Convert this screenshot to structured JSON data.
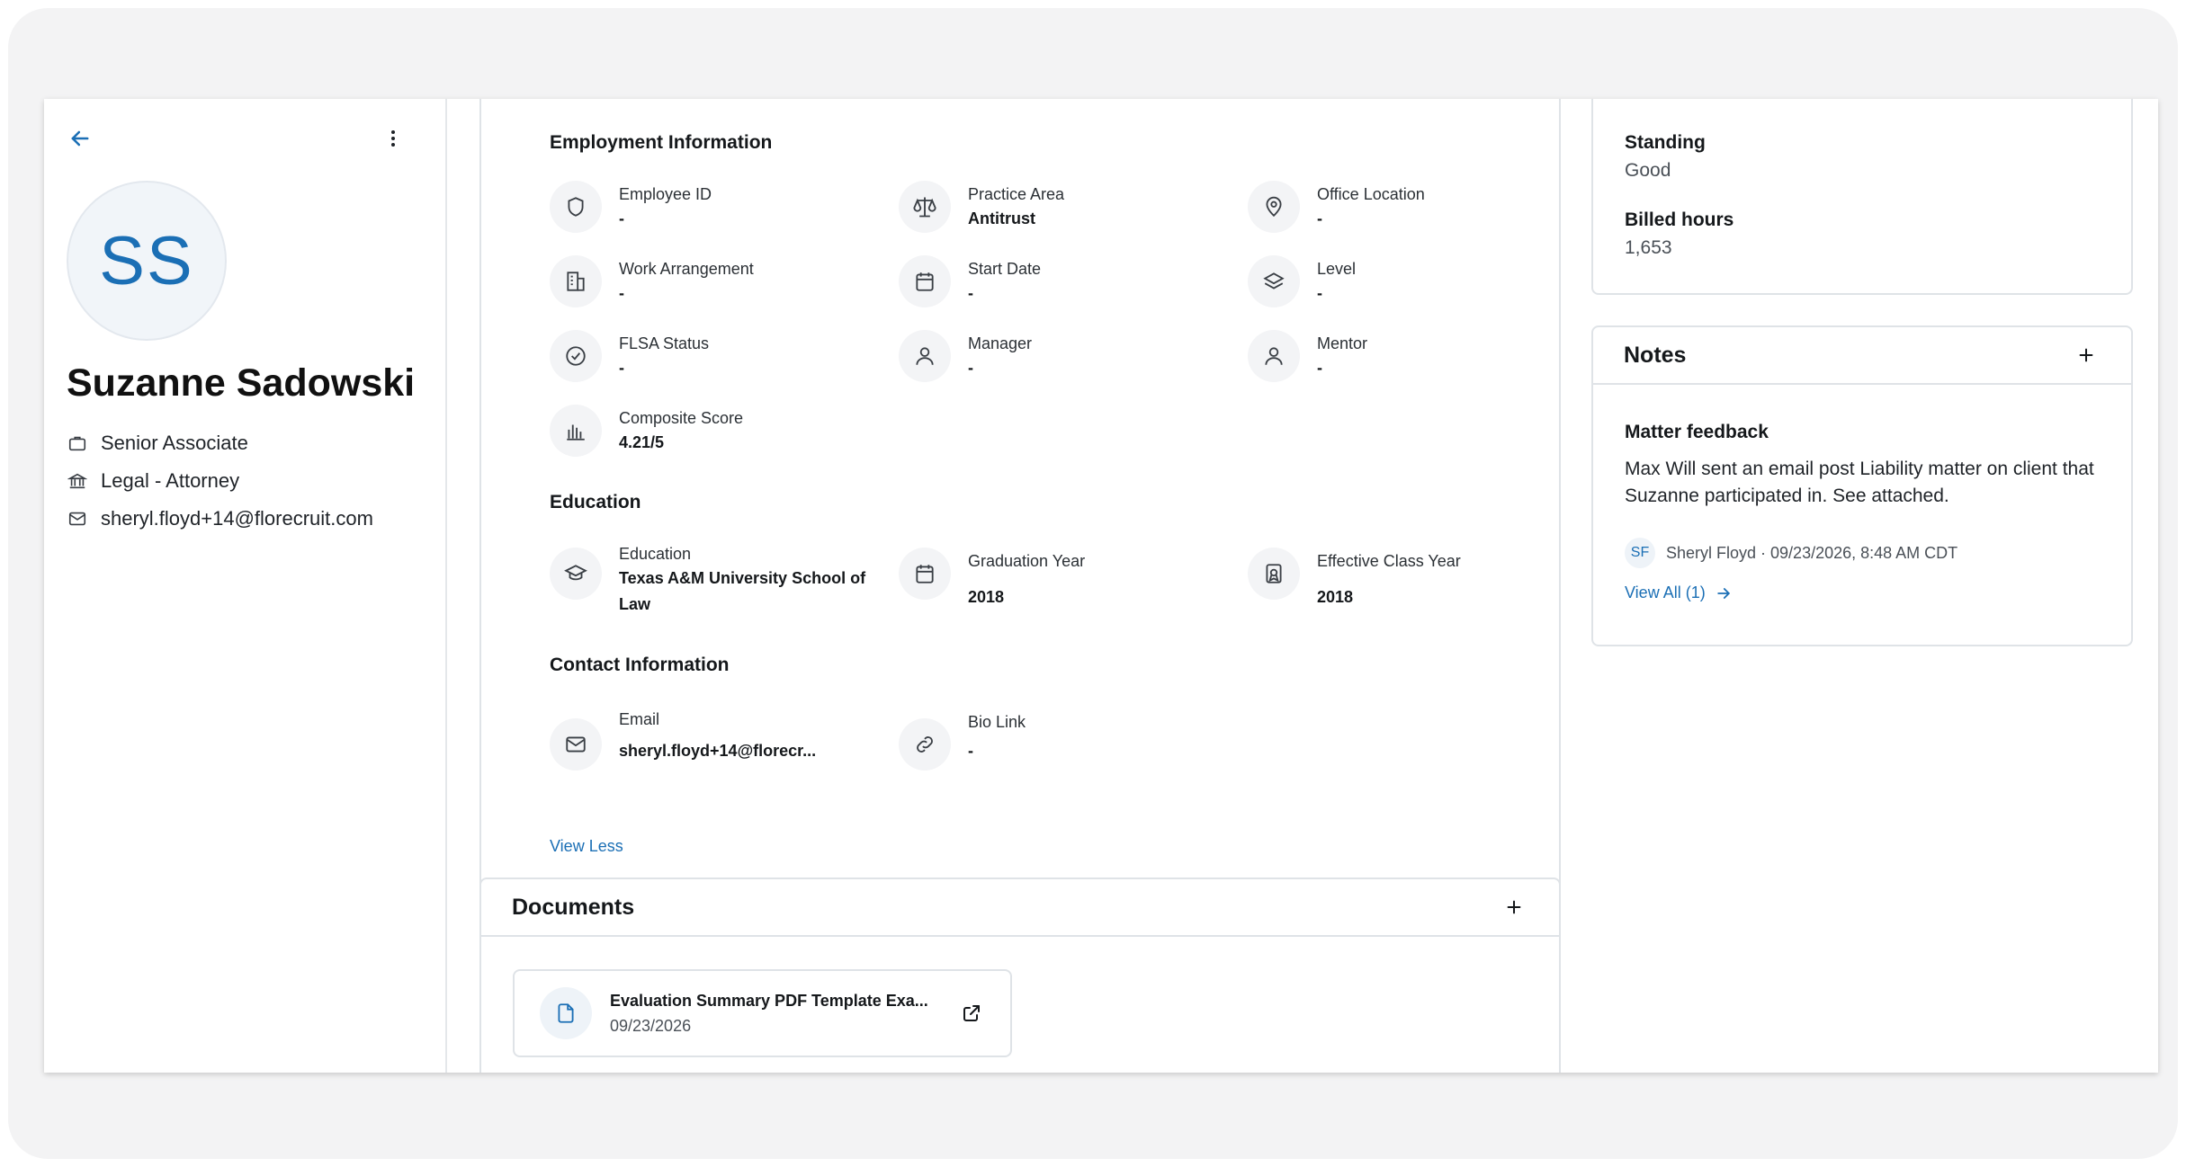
{
  "profile": {
    "initials": "SS",
    "name": "Suzanne Sadowski",
    "title": "Senior Associate",
    "department": "Legal - Attorney",
    "email": "sheryl.floyd+14@florecruit.com"
  },
  "employment": {
    "heading": "Employment Information",
    "fields": [
      {
        "label": "Employee ID",
        "value": "-",
        "icon": "shield-icon"
      },
      {
        "label": "Practice Area",
        "value": "Antitrust",
        "icon": "scale-icon"
      },
      {
        "label": "Office Location",
        "value": "-",
        "icon": "location-pin-icon"
      },
      {
        "label": "Work Arrangement",
        "value": "-",
        "icon": "building-icon"
      },
      {
        "label": "Start Date",
        "value": "-",
        "icon": "calendar-icon"
      },
      {
        "label": "Level",
        "value": "-",
        "icon": "layers-icon"
      },
      {
        "label": "FLSA Status",
        "value": "-",
        "icon": "check-circle-icon"
      },
      {
        "label": "Manager",
        "value": "-",
        "icon": "user-icon"
      },
      {
        "label": "Mentor",
        "value": "-",
        "icon": "user-icon"
      },
      {
        "label": "Composite Score",
        "value": "4.21/5",
        "icon": "bar-chart-icon"
      }
    ]
  },
  "education": {
    "heading": "Education",
    "fields": [
      {
        "label": "Education",
        "value": "Texas A&M University School of Law",
        "icon": "graduation-cap-icon"
      },
      {
        "label": "Graduation Year",
        "value": "2018",
        "icon": "calendar-icon"
      },
      {
        "label": "Effective Class Year",
        "value": "2018",
        "icon": "badge-icon"
      }
    ]
  },
  "contact": {
    "heading": "Contact Information",
    "fields": [
      {
        "label": "Email",
        "value": "sheryl.floyd+14@florecr...",
        "icon": "mail-icon"
      },
      {
        "label": "Bio Link",
        "value": "-",
        "icon": "link-icon"
      }
    ],
    "view_less": "View Less"
  },
  "documents": {
    "heading": "Documents",
    "items": [
      {
        "name": "Evaluation Summary PDF Template Exa...",
        "date": "09/23/2026"
      }
    ]
  },
  "standing": {
    "standing_label": "Standing",
    "standing_value": "Good",
    "hours_label": "Billed hours",
    "hours_value": "1,653"
  },
  "notes": {
    "heading": "Notes",
    "item": {
      "title": "Matter feedback",
      "body": "Max Will sent an email post Liability matter on client that Suzanne participated in. See attached.",
      "author_initials": "SF",
      "author_line": "Sheryl Floyd · 09/23/2026, 8:48 AM CDT"
    },
    "view_all": "View All (1)"
  },
  "colors": {
    "accent": "#1b6fb5",
    "border": "#dfe3e7",
    "icon_bg": "#f3f4f6"
  }
}
